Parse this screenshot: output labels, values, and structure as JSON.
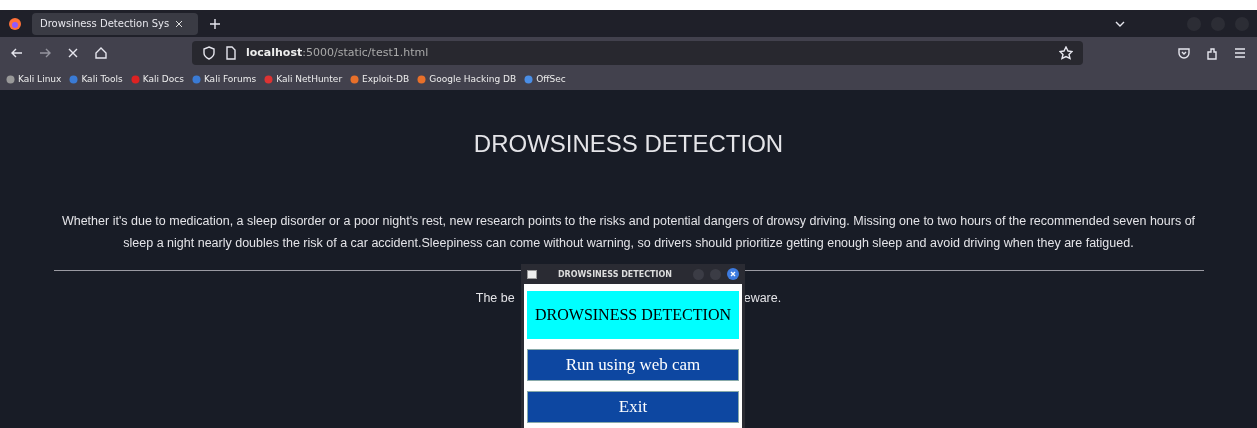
{
  "browser": {
    "tab": {
      "title": "Drowsiness Detection Sys",
      "selected": true
    },
    "address": {
      "host": "localhost",
      "path": ":5000/static/test1.html"
    },
    "bookmarks": [
      "Kali Linux",
      "Kali Tools",
      "Kali Docs",
      "Kali Forums",
      "Kali NetHunter",
      "Exploit-DB",
      "Google Hacking DB",
      "OffSec"
    ]
  },
  "page": {
    "heading": "DROWSINESS DETECTION",
    "paragraph": "Whether it's due to medication, a sleep disorder or a poor night's rest, new research points to the risks and potential dangers of drowsy driving. Missing one to two hours of the recommended seven hours of sleep a night nearly doubles the risk of a car accident.Sleepiness can come without warning, so drivers should prioritize getting enough sleep and avoid driving when they are fatigued.",
    "line_start": "The be",
    "line_end": "eware."
  },
  "dialog": {
    "title": "DROWSINESS DETECTION",
    "banner": "DROWSINESS DETECTION",
    "buttons": [
      "Run using web cam",
      "Exit"
    ]
  }
}
